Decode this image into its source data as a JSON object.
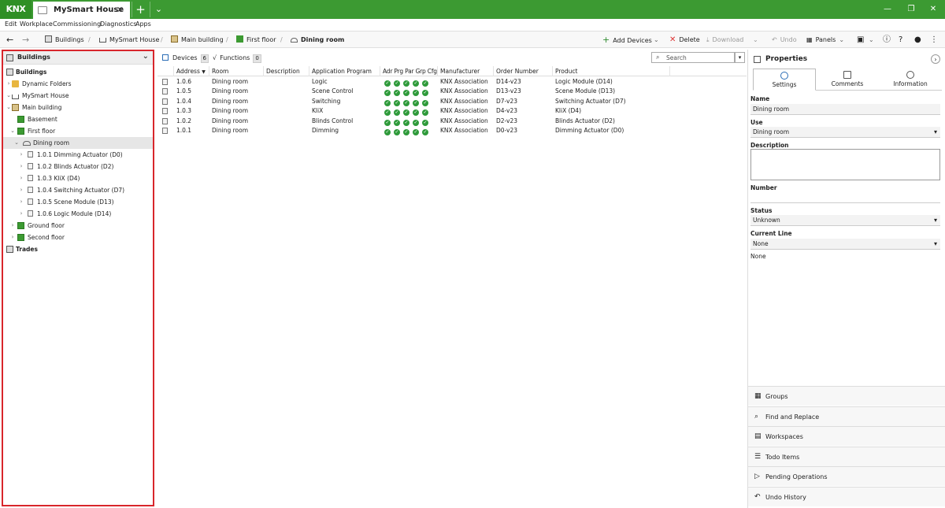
{
  "app": {
    "logo": "KNX",
    "tab_title": "MySmart House",
    "tab_close": "✕",
    "new_tab": "+",
    "tab_menu": "⌄"
  },
  "window": {
    "min": "—",
    "max": "❐",
    "close": "✕"
  },
  "menu": [
    "Edit",
    "Workplace",
    "Commissioning",
    "Diagnostics",
    "Apps"
  ],
  "breadcrumb": [
    "Buildings",
    "MySmart House",
    "Main building",
    "First floor",
    "Dining room"
  ],
  "toolbar": {
    "add_devices": "Add Devices",
    "delete": "Delete",
    "download": "Download",
    "undo": "Undo",
    "panels": "Panels"
  },
  "left": {
    "header": "Buildings",
    "tree": [
      {
        "label": "Buildings",
        "level": 0,
        "icon": "building",
        "arrow": "",
        "bold": true
      },
      {
        "label": "Dynamic Folders",
        "level": 1,
        "icon": "folder",
        "arrow": "›"
      },
      {
        "label": "MySmart House",
        "level": 1,
        "icon": "house",
        "arrow": "⌄"
      },
      {
        "label": "Main building",
        "level": 2,
        "icon": "building",
        "arrow": "⌄"
      },
      {
        "label": "Basement",
        "level": 3,
        "icon": "floor",
        "arrow": ""
      },
      {
        "label": "First floor",
        "level": 3,
        "icon": "floor",
        "arrow": "⌄"
      },
      {
        "label": "Dining room",
        "level": 4,
        "icon": "room",
        "arrow": "⌄",
        "selected": true
      },
      {
        "label": "1.0.1 Dimming Actuator (D0)",
        "level": 5,
        "icon": "device",
        "arrow": "›"
      },
      {
        "label": "1.0.2 Blinds Actuator (D2)",
        "level": 5,
        "icon": "device",
        "arrow": "›"
      },
      {
        "label": "1.0.3 KliX (D4)",
        "level": 5,
        "icon": "device",
        "arrow": "›"
      },
      {
        "label": "1.0.4 Switching Actuator (D7)",
        "level": 5,
        "icon": "device",
        "arrow": "›"
      },
      {
        "label": "1.0.5 Scene Module (D13)",
        "level": 5,
        "icon": "device",
        "arrow": "›"
      },
      {
        "label": "1.0.6 Logic Module (D14)",
        "level": 5,
        "icon": "device",
        "arrow": "›"
      },
      {
        "label": "Ground floor",
        "level": 3,
        "icon": "floor",
        "arrow": "›"
      },
      {
        "label": "Second floor",
        "level": 3,
        "icon": "floor",
        "arrow": "›"
      },
      {
        "label": "Trades",
        "level": 0,
        "icon": "trades",
        "arrow": "",
        "bold": true
      }
    ]
  },
  "center": {
    "tabs": [
      {
        "label": "Devices",
        "count": "6"
      },
      {
        "label": "Functions",
        "count": "0"
      }
    ],
    "search_placeholder": "Search",
    "columns": [
      "Address",
      "Room",
      "Description",
      "Application Program",
      "Adr Prg Par Grp Cfg",
      "Manufacturer",
      "Order Number",
      "Product"
    ],
    "rows": [
      {
        "address": "1.0.6",
        "room": "Dining room",
        "description": "",
        "app": "Logic",
        "manufacturer": "KNX Association",
        "order": "D14-v23",
        "product": "Logic Module (D14)"
      },
      {
        "address": "1.0.5",
        "room": "Dining room",
        "description": "",
        "app": "Scene Control",
        "manufacturer": "KNX Association",
        "order": "D13-v23",
        "product": "Scene Module (D13)"
      },
      {
        "address": "1.0.4",
        "room": "Dining room",
        "description": "",
        "app": "Switching",
        "manufacturer": "KNX Association",
        "order": "D7-v23",
        "product": "Switching Actuator (D7)"
      },
      {
        "address": "1.0.3",
        "room": "Dining room",
        "description": "",
        "app": "KliX",
        "manufacturer": "KNX Association",
        "order": "D4-v23",
        "product": "KliX (D4)"
      },
      {
        "address": "1.0.2",
        "room": "Dining room",
        "description": "",
        "app": "Blinds Control",
        "manufacturer": "KNX Association",
        "order": "D2-v23",
        "product": "Blinds Actuator (D2)"
      },
      {
        "address": "1.0.1",
        "room": "Dining room",
        "description": "",
        "app": "Dimming",
        "manufacturer": "KNX Association",
        "order": "D0-v23",
        "product": "Dimming Actuator (D0)"
      }
    ]
  },
  "properties": {
    "title": "Properties",
    "tabs": [
      "Settings",
      "Comments",
      "Information"
    ],
    "name_label": "Name",
    "name_value": "Dining room",
    "use_label": "Use",
    "use_value": "Dining room",
    "description_label": "Description",
    "number_label": "Number",
    "status_label": "Status",
    "status_value": "Unknown",
    "current_line_label": "Current Line",
    "current_line_value": "None",
    "current_line_text": "None"
  },
  "accordion": [
    "Groups",
    "Find and Replace",
    "Workspaces",
    "Todo Items",
    "Pending Operations",
    "Undo History"
  ]
}
